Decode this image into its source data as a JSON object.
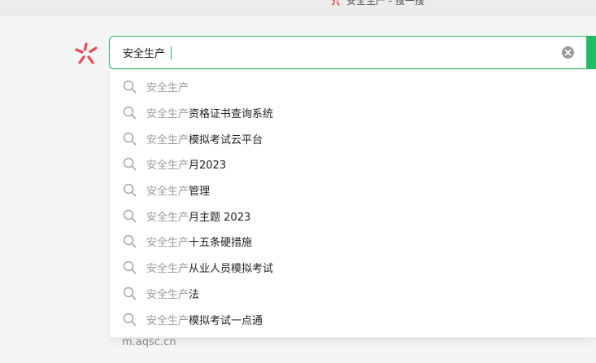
{
  "tab": {
    "title": "安全生产 - 搜一搜"
  },
  "search": {
    "value": "安全生产",
    "query_prefix": "安全生产"
  },
  "suggestions": [
    {
      "rest": ""
    },
    {
      "rest": "资格证书查询系统"
    },
    {
      "rest": "模拟考试云平台"
    },
    {
      "rest": "月2023"
    },
    {
      "rest": "管理"
    },
    {
      "rest": "月主题 2023"
    },
    {
      "rest": "十五条硬措施"
    },
    {
      "rest": "从业人员模拟考试"
    },
    {
      "rest": "法"
    },
    {
      "rest": "模拟考试一点通"
    }
  ],
  "result_peek": {
    "url": "m.aqsc.cn"
  },
  "colors": {
    "accent": "#1dbf62",
    "logo": "#f0464f"
  }
}
